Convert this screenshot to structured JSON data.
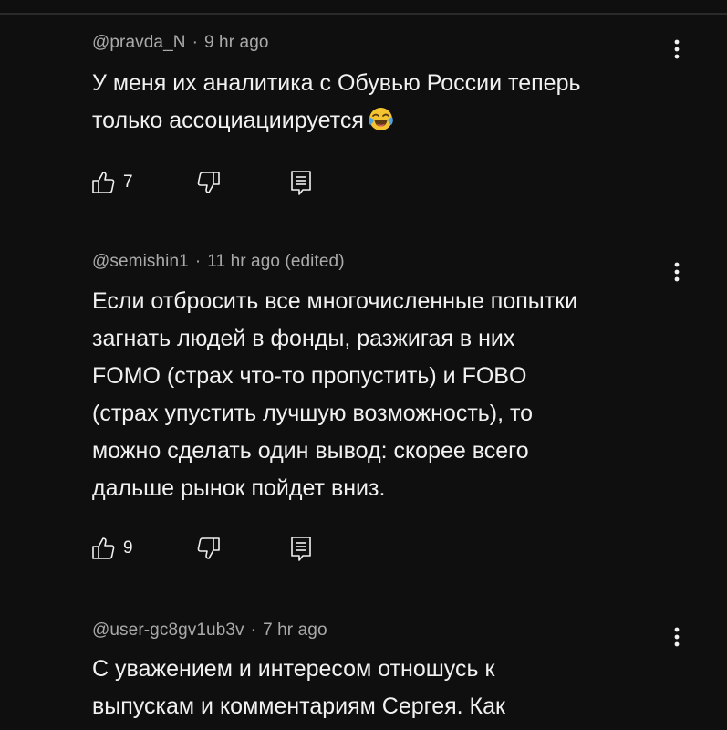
{
  "comments": [
    {
      "author": "@pravda_N",
      "separator": "·",
      "time": "9 hr ago",
      "text": "У меня их аналитика с Обувью России теперь\nтолько ассоциациируется",
      "emoji": "face-with-tears-of-joy",
      "likes": "7"
    },
    {
      "author": "@semishin1",
      "separator": "·",
      "time": "11 hr ago (edited)",
      "text": "Если отбросить все многочисленные попытки\nзагнать людей в фонды, разжигая в них\nFOMO (страх что-то пропустить) и FOBO\n(страх упустить лучшую возможность), то\nможно сделать один вывод: скорее всего\nдальше рынок пойдет вниз.",
      "likes": "9"
    },
    {
      "author": "@user-gc8gv1ub3v",
      "separator": "·",
      "time": "7 hr ago",
      "text": "С уважением и интересом отношусь к\nвыпускам и комментариям Сергея. Как"
    }
  ],
  "icons": {
    "like": "thumbs-up-icon",
    "dislike": "thumbs-down-icon",
    "reply": "reply-icon",
    "menu": "more-vertical-icon"
  },
  "colors": {
    "background": "#0f0f0f",
    "text": "#f1f1f1",
    "meta": "#aaaaaa"
  }
}
